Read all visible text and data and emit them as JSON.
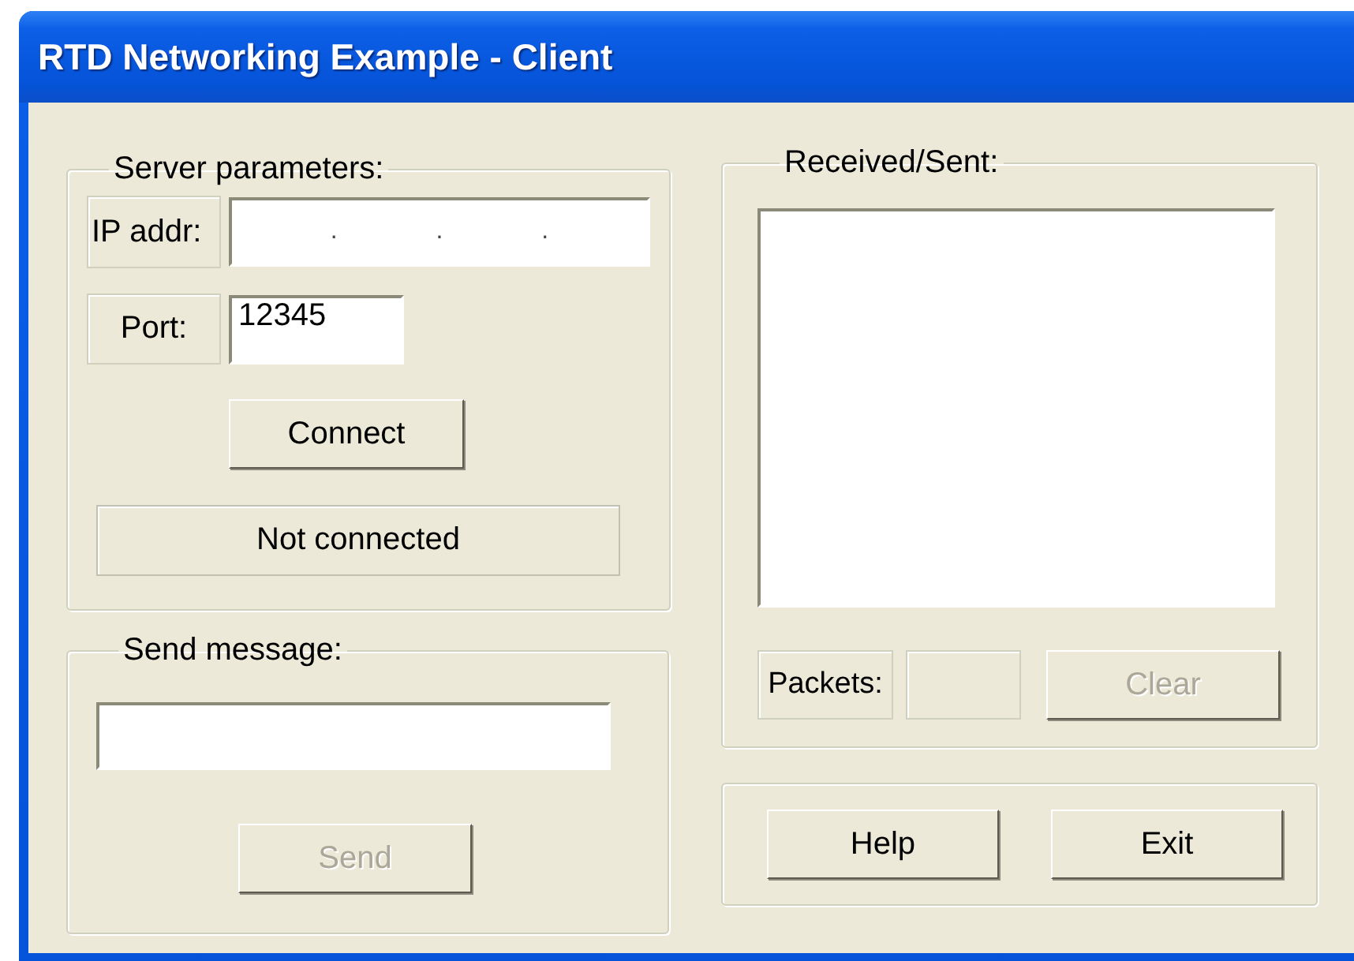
{
  "window": {
    "title": "RTD Networking Example - Client"
  },
  "server_parameters": {
    "legend": "Server parameters:",
    "ip_label": "IP addr:",
    "ip_field": {
      "separators": [
        ".",
        ".",
        "."
      ]
    },
    "port_label": "Port:",
    "port_field": {
      "value": "12345"
    },
    "connect_button": {
      "label": "Connect",
      "disabled": false
    },
    "status": "Not connected"
  },
  "send_message": {
    "legend": "Send message:",
    "send_button": {
      "label": "Send",
      "disabled": true
    }
  },
  "received_sent": {
    "legend": "Received/Sent:",
    "packets_label": "Packets:",
    "clear_button": {
      "label": "Clear",
      "disabled": true
    }
  },
  "buttons": [
    {
      "label": "Help",
      "disabled": false
    },
    {
      "label": "Exit",
      "disabled": false
    }
  ]
}
